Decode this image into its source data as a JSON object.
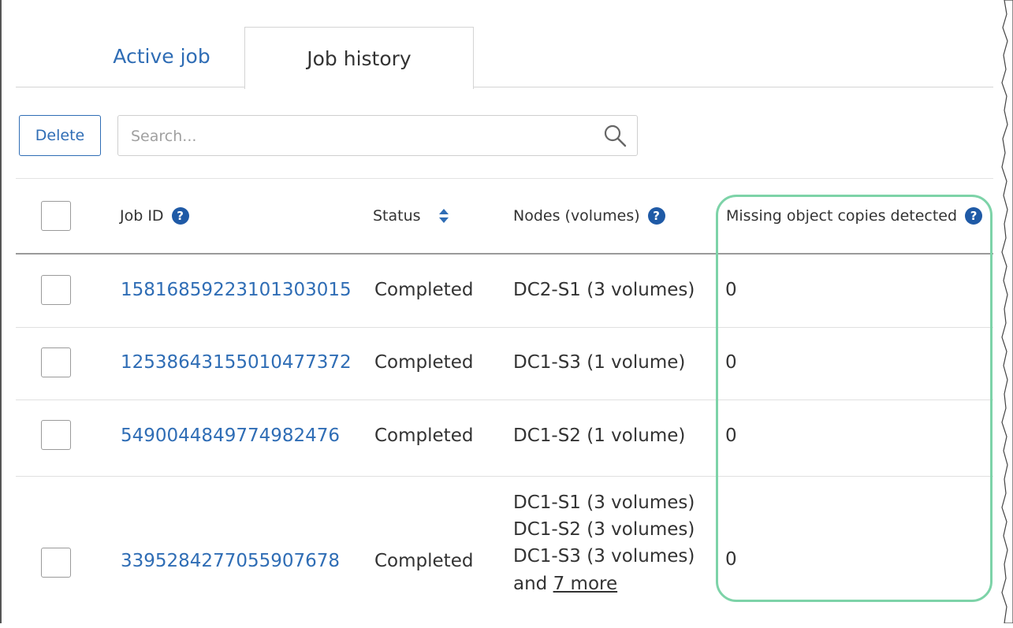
{
  "tabs": {
    "active_job": "Active job",
    "job_history": "Job history"
  },
  "toolbar": {
    "delete_label": "Delete",
    "search_placeholder": "Search..."
  },
  "table": {
    "headers": {
      "job_id": "Job ID",
      "status": "Status",
      "nodes": "Nodes (volumes)",
      "missing": "Missing object copies detected"
    },
    "help_glyph": "?",
    "rows": [
      {
        "job_id": "15816859223101303015",
        "status": "Completed",
        "nodes": [
          "DC2-S1 (3 volumes)"
        ],
        "missing": "0"
      },
      {
        "job_id": "12538643155010477372",
        "status": "Completed",
        "nodes": [
          "DC1-S3 (1 volume)"
        ],
        "missing": "0"
      },
      {
        "job_id": "5490044849774982476",
        "status": "Completed",
        "nodes": [
          "DC1-S2 (1 volume)"
        ],
        "missing": "0"
      },
      {
        "job_id": "3395284277055907678",
        "status": "Completed",
        "nodes": [
          "DC1-S1 (3 volumes)",
          "DC1-S2 (3 volumes)",
          "DC1-S3 (3 volumes)"
        ],
        "more_prefix": "and ",
        "more_link": "7 more",
        "missing": "0"
      }
    ]
  },
  "colors": {
    "link": "#2f6db5",
    "help_icon": "#1f5aa6",
    "highlight": "#7dd3a8"
  }
}
